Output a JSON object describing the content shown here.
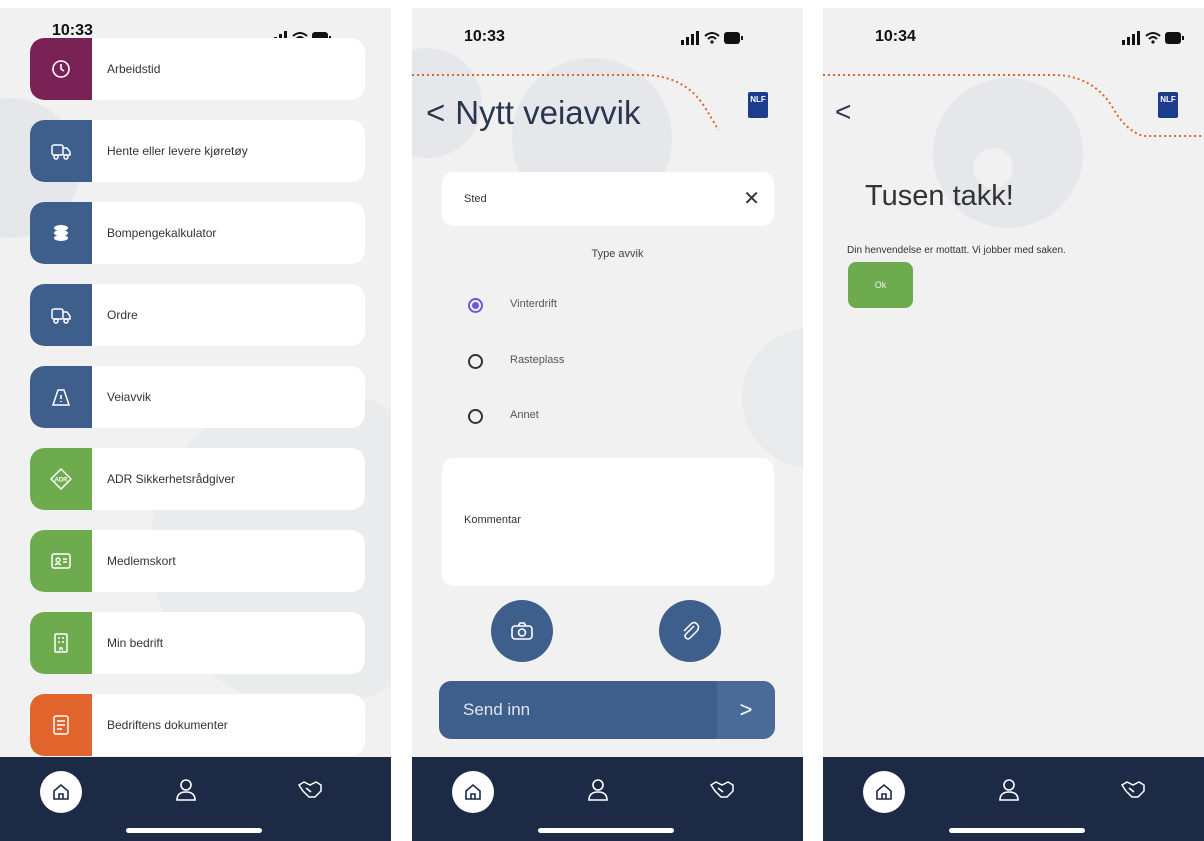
{
  "screens": [
    {
      "time": "10:33",
      "menu": [
        {
          "label": "Arbeidstid",
          "icon": "clock-icon",
          "color": "#7a2155"
        },
        {
          "label": "Hente eller levere kjøretøy",
          "icon": "truck-icon",
          "color": "#3e5f8c"
        },
        {
          "label": "Bompengekalkulator",
          "icon": "coins-icon",
          "color": "#3e5f8c"
        },
        {
          "label": "Ordre",
          "icon": "truck-icon",
          "color": "#3e5f8c"
        },
        {
          "label": "Veiavvik",
          "icon": "road-warning-icon",
          "color": "#3e5f8c"
        },
        {
          "label": "ADR Sikkerhetsrådgiver",
          "icon": "adr-icon",
          "color": "#6eab4e"
        },
        {
          "label": "Medlemskort",
          "icon": "id-card-icon",
          "color": "#6eab4e"
        },
        {
          "label": "Min bedrift",
          "icon": "building-icon",
          "color": "#6eab4e"
        },
        {
          "label": "Bedriftens dokumenter",
          "icon": "document-icon",
          "color": "#e0642b"
        }
      ]
    },
    {
      "time": "10:33",
      "title": "Nytt veiavvik",
      "back": "<",
      "logo": "NLF",
      "sted_placeholder": "Sted",
      "clear": "✕",
      "type_label": "Type avvik",
      "options": [
        {
          "label": "Vinterdrift",
          "selected": true
        },
        {
          "label": "Rasteplass",
          "selected": false
        },
        {
          "label": "Annet",
          "selected": false
        }
      ],
      "comment_placeholder": "Kommentar",
      "submit": "Send inn",
      "submit_arrow": ">"
    },
    {
      "time": "10:34",
      "back": "<",
      "logo": "NLF",
      "title": "Tusen takk!",
      "message": "Din henvendelse er mottatt. Vi jobber med saken.",
      "ok": "Ok"
    }
  ],
  "colors": {
    "nav": "#1c2a46",
    "accent_blue": "#3e5f8c",
    "accent_green": "#6eab4e",
    "accent_orange": "#e0642b"
  }
}
